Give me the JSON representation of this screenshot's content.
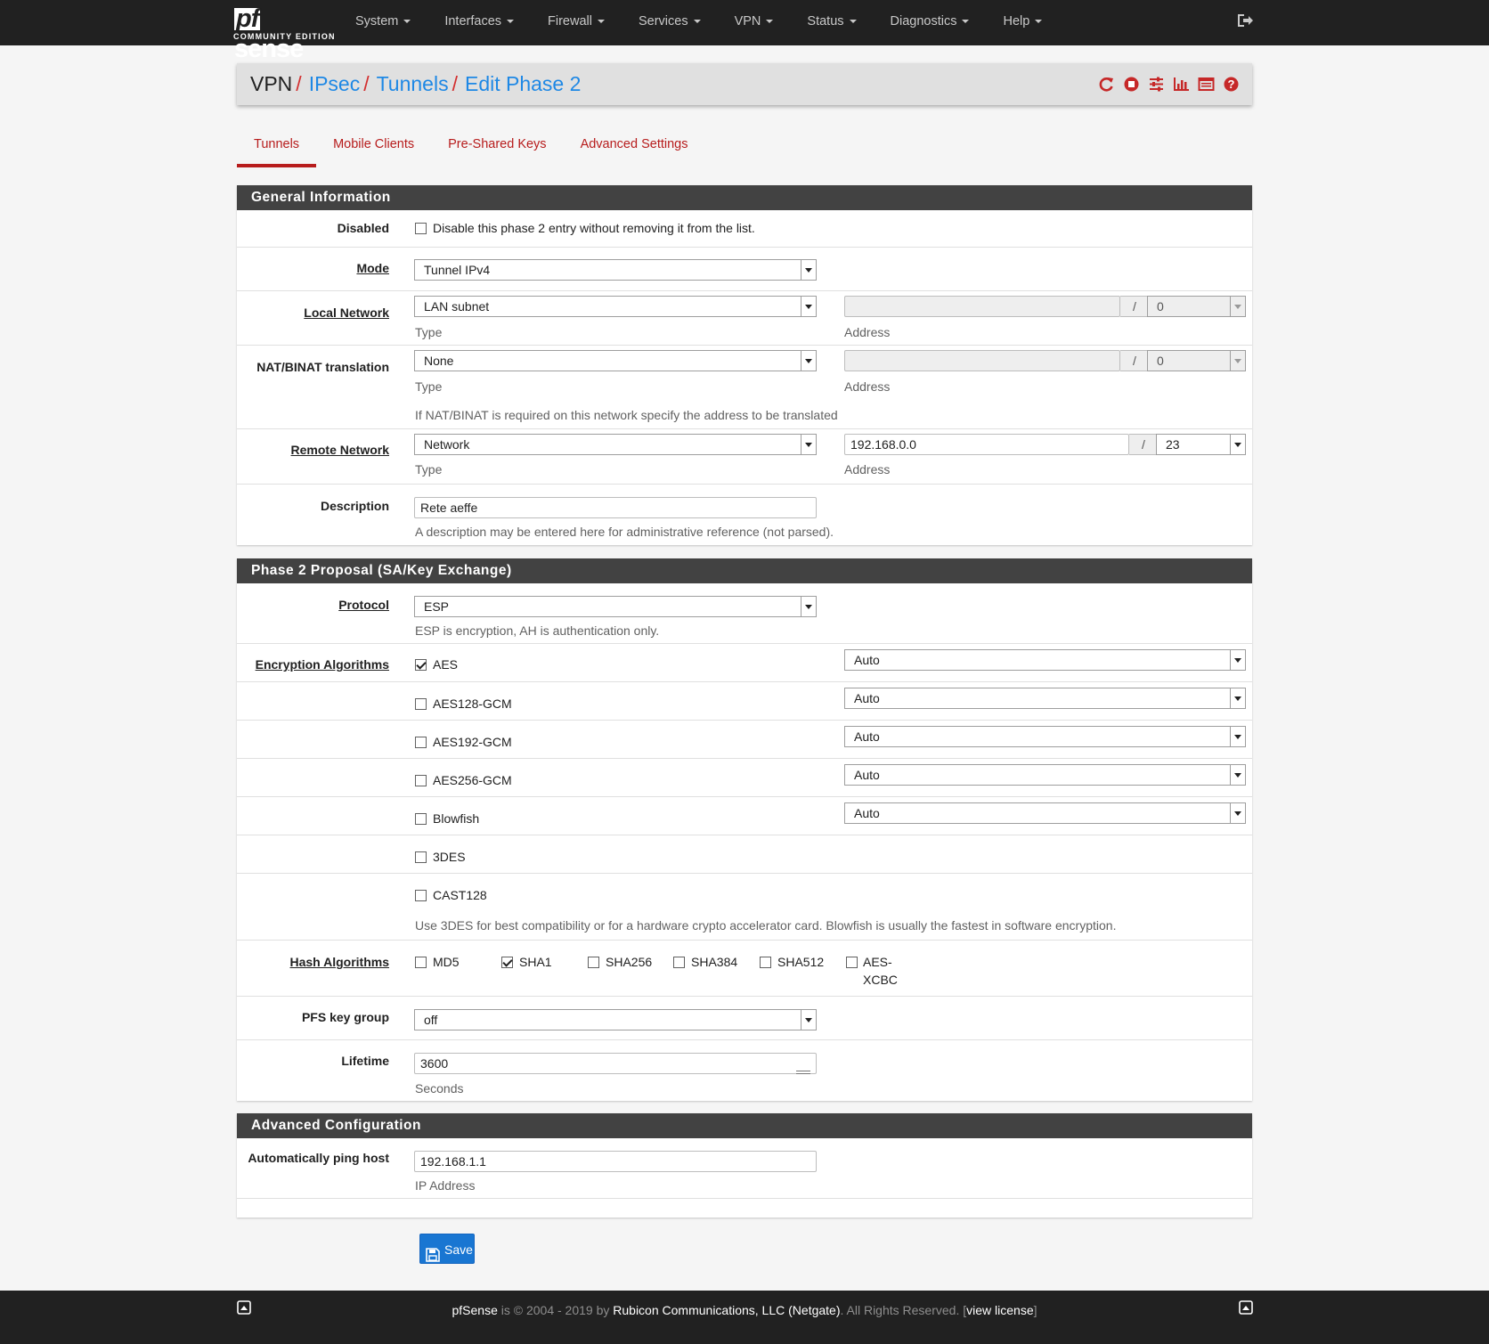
{
  "brand": {
    "name": "sense",
    "prefix": "pf",
    "edition": "COMMUNITY EDITION"
  },
  "nav": {
    "items": [
      "System",
      "Interfaces",
      "Firewall",
      "Services",
      "VPN",
      "Status",
      "Diagnostics",
      "Help"
    ]
  },
  "breadcrumb": {
    "items": [
      "VPN",
      "IPsec",
      "Tunnels",
      "Edit Phase 2"
    ],
    "separator": "/"
  },
  "tabs": [
    "Tunnels",
    "Mobile Clients",
    "Pre-Shared Keys",
    "Advanced Settings"
  ],
  "general": {
    "title": "General Information",
    "disabled": {
      "label": "Disabled",
      "text": "Disable this phase 2 entry without removing it from the list.",
      "checked": false
    },
    "mode": {
      "label": "Mode",
      "value": "Tunnel IPv4"
    },
    "local": {
      "label": "Local Network",
      "type": "LAN subnet",
      "type_hint": "Type",
      "address": "",
      "mask": "0",
      "address_hint": "Address"
    },
    "nat": {
      "label": "NAT/BINAT translation",
      "type": "None",
      "type_hint": "Type",
      "address": "",
      "mask": "0",
      "address_hint": "Address",
      "note": "If NAT/BINAT is required on this network specify the address to be translated"
    },
    "remote": {
      "label": "Remote Network",
      "type": "Network",
      "type_hint": "Type",
      "address": "192.168.0.0",
      "mask": "23",
      "address_hint": "Address"
    },
    "description": {
      "label": "Description",
      "value": "Rete aeffe",
      "hint": "A description may be entered here for administrative reference (not parsed)."
    }
  },
  "phase2": {
    "title": "Phase 2 Proposal (SA/Key Exchange)",
    "protocol": {
      "label": "Protocol",
      "value": "ESP",
      "hint": "ESP is encryption, AH is authentication only."
    },
    "encryption_label": "Encryption Algorithms",
    "encryption": [
      {
        "name": "AES",
        "checked": true,
        "keylen": "Auto"
      },
      {
        "name": "AES128-GCM",
        "checked": false,
        "keylen": "Auto"
      },
      {
        "name": "AES192-GCM",
        "checked": false,
        "keylen": "Auto"
      },
      {
        "name": "AES256-GCM",
        "checked": false,
        "keylen": "Auto"
      },
      {
        "name": "Blowfish",
        "checked": false,
        "keylen": "Auto"
      },
      {
        "name": "3DES",
        "checked": false
      },
      {
        "name": "CAST128",
        "checked": false
      }
    ],
    "encryption_hint": "Use 3DES for best compatibility or for a hardware crypto accelerator card. Blowfish is usually the fastest in software encryption.",
    "hash_label": "Hash Algorithms",
    "hash": [
      {
        "name": "MD5",
        "checked": false
      },
      {
        "name": "SHA1",
        "checked": true
      },
      {
        "name": "SHA256",
        "checked": false
      },
      {
        "name": "SHA384",
        "checked": false
      },
      {
        "name": "SHA512",
        "checked": false
      },
      {
        "name": "AES-",
        "name2": "XCBC",
        "checked": false
      }
    ],
    "pfs": {
      "label": "PFS key group",
      "value": "off"
    },
    "lifetime": {
      "label": "Lifetime",
      "value": "3600",
      "hint": "Seconds"
    }
  },
  "advanced": {
    "title": "Advanced Configuration",
    "ping": {
      "label": "Automatically ping host",
      "value": "192.168.1.1",
      "hint": "IP Address"
    }
  },
  "save_label": "Save",
  "footer": {
    "product": "pfSense",
    "text1": " is © 2004 - 2019 by ",
    "company": "Rubicon Communications, LLC (Netgate)",
    "text2": ". All Rights Reserved. [",
    "license": "view license",
    "text3": "]"
  },
  "colors": {
    "accent": "#b71c1c",
    "link": "#1e88e5",
    "navbar": "#212121",
    "panel_head": "#424242",
    "button": "#1976d2"
  }
}
